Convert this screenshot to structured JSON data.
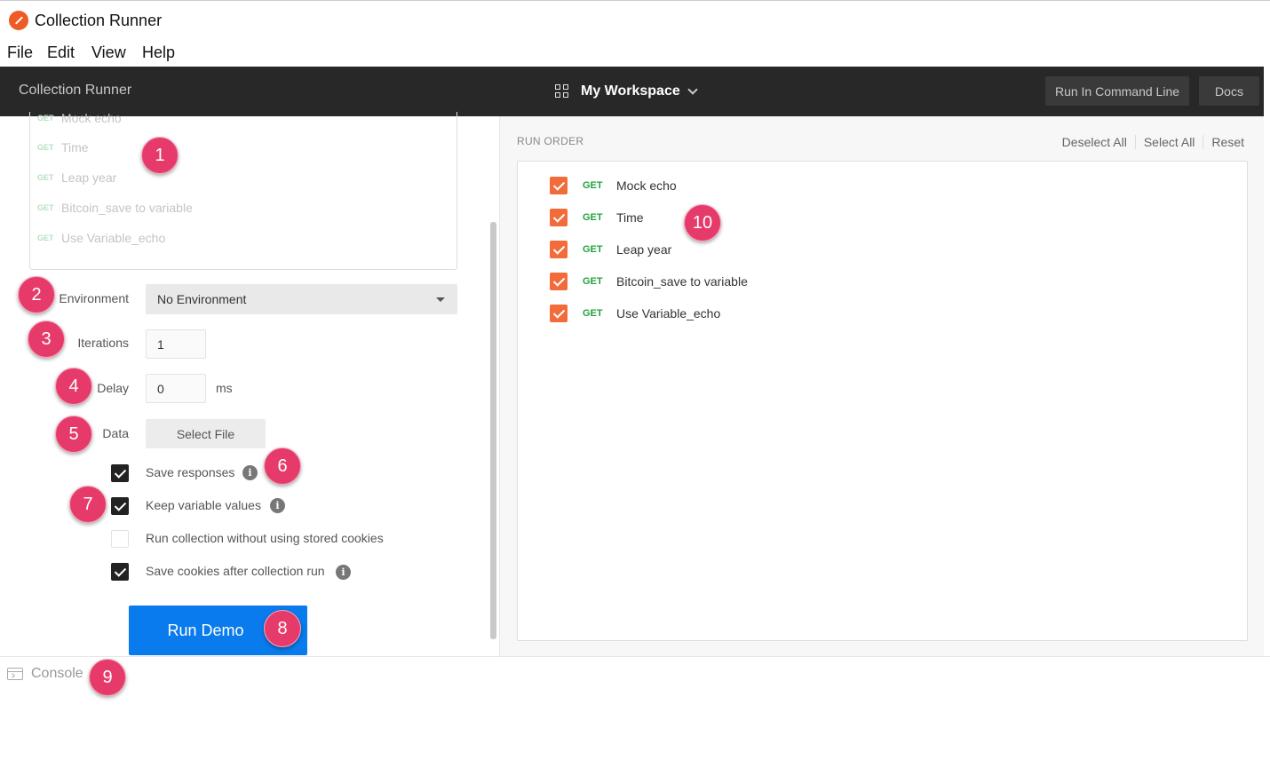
{
  "window": {
    "title": "Collection Runner"
  },
  "menu": [
    "File",
    "Edit",
    "View",
    "Help"
  ],
  "header": {
    "title": "Collection Runner",
    "workspace": "My Workspace",
    "run_cli_label": "Run In Command Line",
    "docs_label": "Docs"
  },
  "requests": [
    {
      "method": "GET",
      "name": "Mock echo"
    },
    {
      "method": "GET",
      "name": "Time"
    },
    {
      "method": "GET",
      "name": "Leap year"
    },
    {
      "method": "GET",
      "name": "Bitcoin_save to variable"
    },
    {
      "method": "GET",
      "name": "Use Variable_echo"
    }
  ],
  "settings": {
    "environment_label": "Environment",
    "environment_value": "No Environment",
    "iterations_label": "Iterations",
    "iterations_value": "1",
    "delay_label": "Delay",
    "delay_value": "0",
    "delay_unit": "ms",
    "data_label": "Data",
    "select_file_label": "Select File",
    "options": [
      {
        "label": "Save responses",
        "checked": true,
        "info": true
      },
      {
        "label": "Keep variable values",
        "checked": true,
        "info": true
      },
      {
        "label": "Run collection without using stored cookies",
        "checked": false,
        "info": false
      },
      {
        "label": "Save cookies after collection run",
        "checked": true,
        "info": true
      }
    ],
    "run_button_label": "Run Demo"
  },
  "run_order": {
    "title": "RUN ORDER",
    "deselect_all": "Deselect All",
    "select_all": "Select All",
    "reset": "Reset"
  },
  "console": {
    "label": "Console"
  },
  "badges": [
    "1",
    "2",
    "3",
    "4",
    "5",
    "6",
    "7",
    "8",
    "9",
    "10"
  ],
  "colors": {
    "accent_blue": "#097bed",
    "checkbox_orange": "#f26b3a",
    "get_green": "#24a23e",
    "badge_pink": "#e63a6a"
  }
}
